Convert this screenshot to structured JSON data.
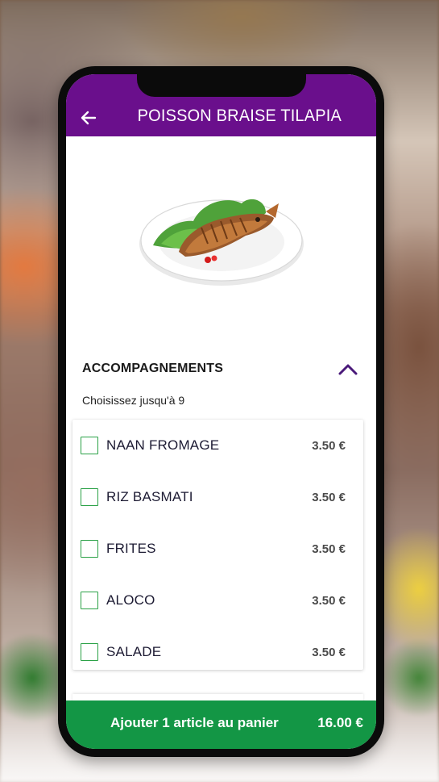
{
  "header": {
    "title": "POISSON BRAISE TILAPIA",
    "back_icon": "arrow-left-icon",
    "bar_color": "#6a0f8c"
  },
  "section": {
    "title": "ACCOMPAGNEMENTS",
    "toggle_icon": "chevron-up-icon",
    "subtitle": "Choisissez jusqu'à 9",
    "options": [
      {
        "label": "NAAN FROMAGE",
        "price": "3.50 €",
        "checked": false
      },
      {
        "label": "RIZ BASMATI",
        "price": "3.50 €",
        "checked": false
      },
      {
        "label": "FRITES",
        "price": "3.50 €",
        "checked": false
      },
      {
        "label": "ALOCO",
        "price": "3.50 €",
        "checked": false
      },
      {
        "label": "SALADE",
        "price": "3.50 €",
        "checked": false
      }
    ]
  },
  "cart": {
    "button_label": "Ajouter 1 article au panier",
    "total": "16.00 €",
    "color": "#139645"
  },
  "colors": {
    "accent": "#6a0f8c",
    "checkbox_border": "#2aa146"
  }
}
